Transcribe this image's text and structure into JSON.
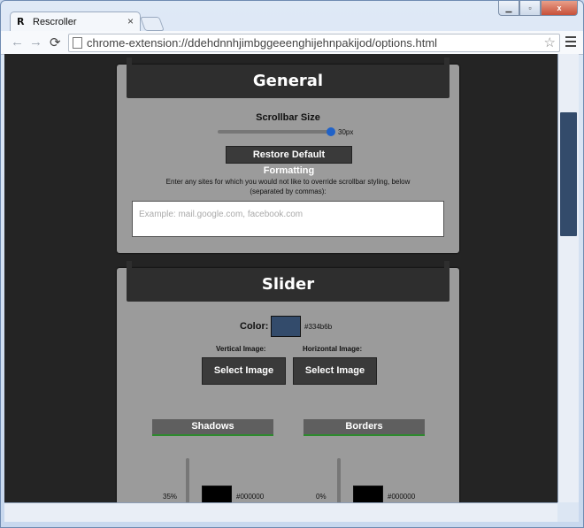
{
  "browser": {
    "tab_title": "Rescroller",
    "tab_icon_label": "R",
    "tab_close": "×",
    "url": "chrome-extension://ddehdnnhjimbggeeenghijehnpakijod/options.html",
    "star": "☆",
    "back": "←",
    "forward": "→",
    "reload": "C"
  },
  "general": {
    "title": "General",
    "scrollbar_size_label": "Scrollbar Size",
    "scrollbar_size_value": "30px",
    "scrollbar_size_fraction": 1.0,
    "restore_button": "Restore Default Formatting",
    "exclude_note": "Enter any sites for which you would not like to override scrollbar styling, below (separated by commas):",
    "exclude_placeholder": "Example: mail.google.com, facebook.com"
  },
  "slider": {
    "title": "Slider",
    "color_label": "Color:",
    "color_value": "#334b6b",
    "vertical_image_label": "Vertical Image:",
    "horizontal_image_label": "Horizontal Image:",
    "select_image_vertical": "Select Image",
    "select_image_horizontal": "Select Image"
  },
  "shadows": {
    "title": "Shadows",
    "percent": "35%",
    "color_value": "#000000"
  },
  "borders": {
    "title": "Borders",
    "percent": "0%",
    "color_value": "#000000"
  },
  "colors": {
    "accent": "#2d8a2d",
    "slider_color": "#334b6b",
    "shadow_color": "#000000",
    "border_color": "#000000"
  }
}
